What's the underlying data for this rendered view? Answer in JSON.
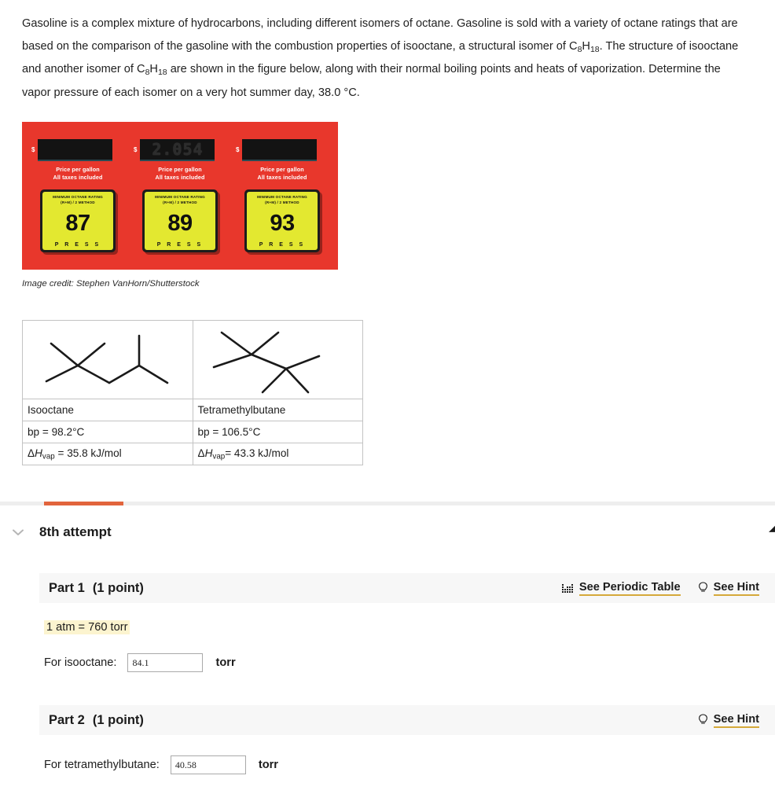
{
  "problem": {
    "paragraph_part_1": "Gasoline is a complex mixture of hydrocarbons, including different isomers of octane. Gasoline is sold with a variety of octane ratings that are based on the comparison of the gasoline with the combustion properties of isooctane, a structural isomer of C",
    "formula_1_sub_c": "8",
    "formula_1_h": "H",
    "formula_1_sub_h": "18",
    "paragraph_part_2": ". The structure of isooctane and another isomer of C",
    "formula_2_sub_c": "8",
    "formula_2_h": "H",
    "formula_2_sub_h": "18",
    "paragraph_part_3": " are shown in the figure below, along with their normal boiling points and heats of vaporization. Determine the vapor pressure of each isomer on a very hot summer day, 38.0 °C."
  },
  "figure": {
    "credit": "Image credit: Stephen VanHorn/Shutterstock",
    "pump_color": "#e8372c",
    "button_color": "#e3e830",
    "pumps": [
      {
        "dollar_sign": "$",
        "price_display": "",
        "price_label_line1": "Price per gallon",
        "price_label_line2": "All taxes included",
        "octane_heading_line1": "MINIMUM OCTANE RATING",
        "octane_heading_line2": "(R+M) / 2 METHOD",
        "octane_number": "87",
        "press_label": "P R E S S"
      },
      {
        "dollar_sign": "$",
        "price_display": "2.054",
        "price_label_line1": "Price per gallon",
        "price_label_line2": "All taxes included",
        "octane_heading_line1": "MINIMUM OCTANE RATING",
        "octane_heading_line2": "(R+M) / 2 METHOD",
        "octane_number": "89",
        "press_label": "P R E S S"
      },
      {
        "dollar_sign": "$",
        "price_display": "",
        "price_label_line1": "Price per gallon",
        "price_label_line2": "All taxes included",
        "octane_heading_line1": "MINIMUM OCTANE RATING",
        "octane_heading_line2": "(R+M) / 2 METHOD",
        "octane_number": "93",
        "press_label": "P R E S S"
      }
    ]
  },
  "isomer_table": {
    "columns": [
      {
        "structure_name": "isooctane-skeletal-structure",
        "name": "Isooctane",
        "bp": "bp = 98.2°C",
        "hvap_delta": "Δ",
        "hvap_h": "H",
        "hvap_sub": "vap",
        "hvap_value": " = 35.8 kJ/mol"
      },
      {
        "structure_name": "tetramethylbutane-skeletal-structure",
        "name": "Tetramethylbutane",
        "bp": "bp = 106.5°C",
        "hvap_delta": "Δ",
        "hvap_h": "H",
        "hvap_sub": "vap",
        "hvap_value": "= 43.3 kJ/mol"
      }
    ]
  },
  "attempt": {
    "title": "8th attempt",
    "chevron_icon": "chevron-down-icon",
    "tab_accent_color": "#e2643c"
  },
  "parts": [
    {
      "title": "Part 1",
      "points": "(1 point)",
      "links": [
        {
          "icon": "periodic-table-icon",
          "label": "See Periodic Table"
        },
        {
          "icon": "lightbulb-icon",
          "label": "See Hint"
        }
      ],
      "conversion_note": "1 atm = 760 torr",
      "highlight_color": "#fcf4cf",
      "answer_label": "For isooctane:",
      "answer_value": "84.1",
      "answer_unit": "torr"
    },
    {
      "title": "Part 2",
      "points": "(1 point)",
      "links": [
        {
          "icon": "lightbulb-icon",
          "label": "See Hint"
        }
      ],
      "answer_label": "For tetramethylbutane:",
      "answer_value": "40.58",
      "answer_unit": "torr"
    }
  ]
}
